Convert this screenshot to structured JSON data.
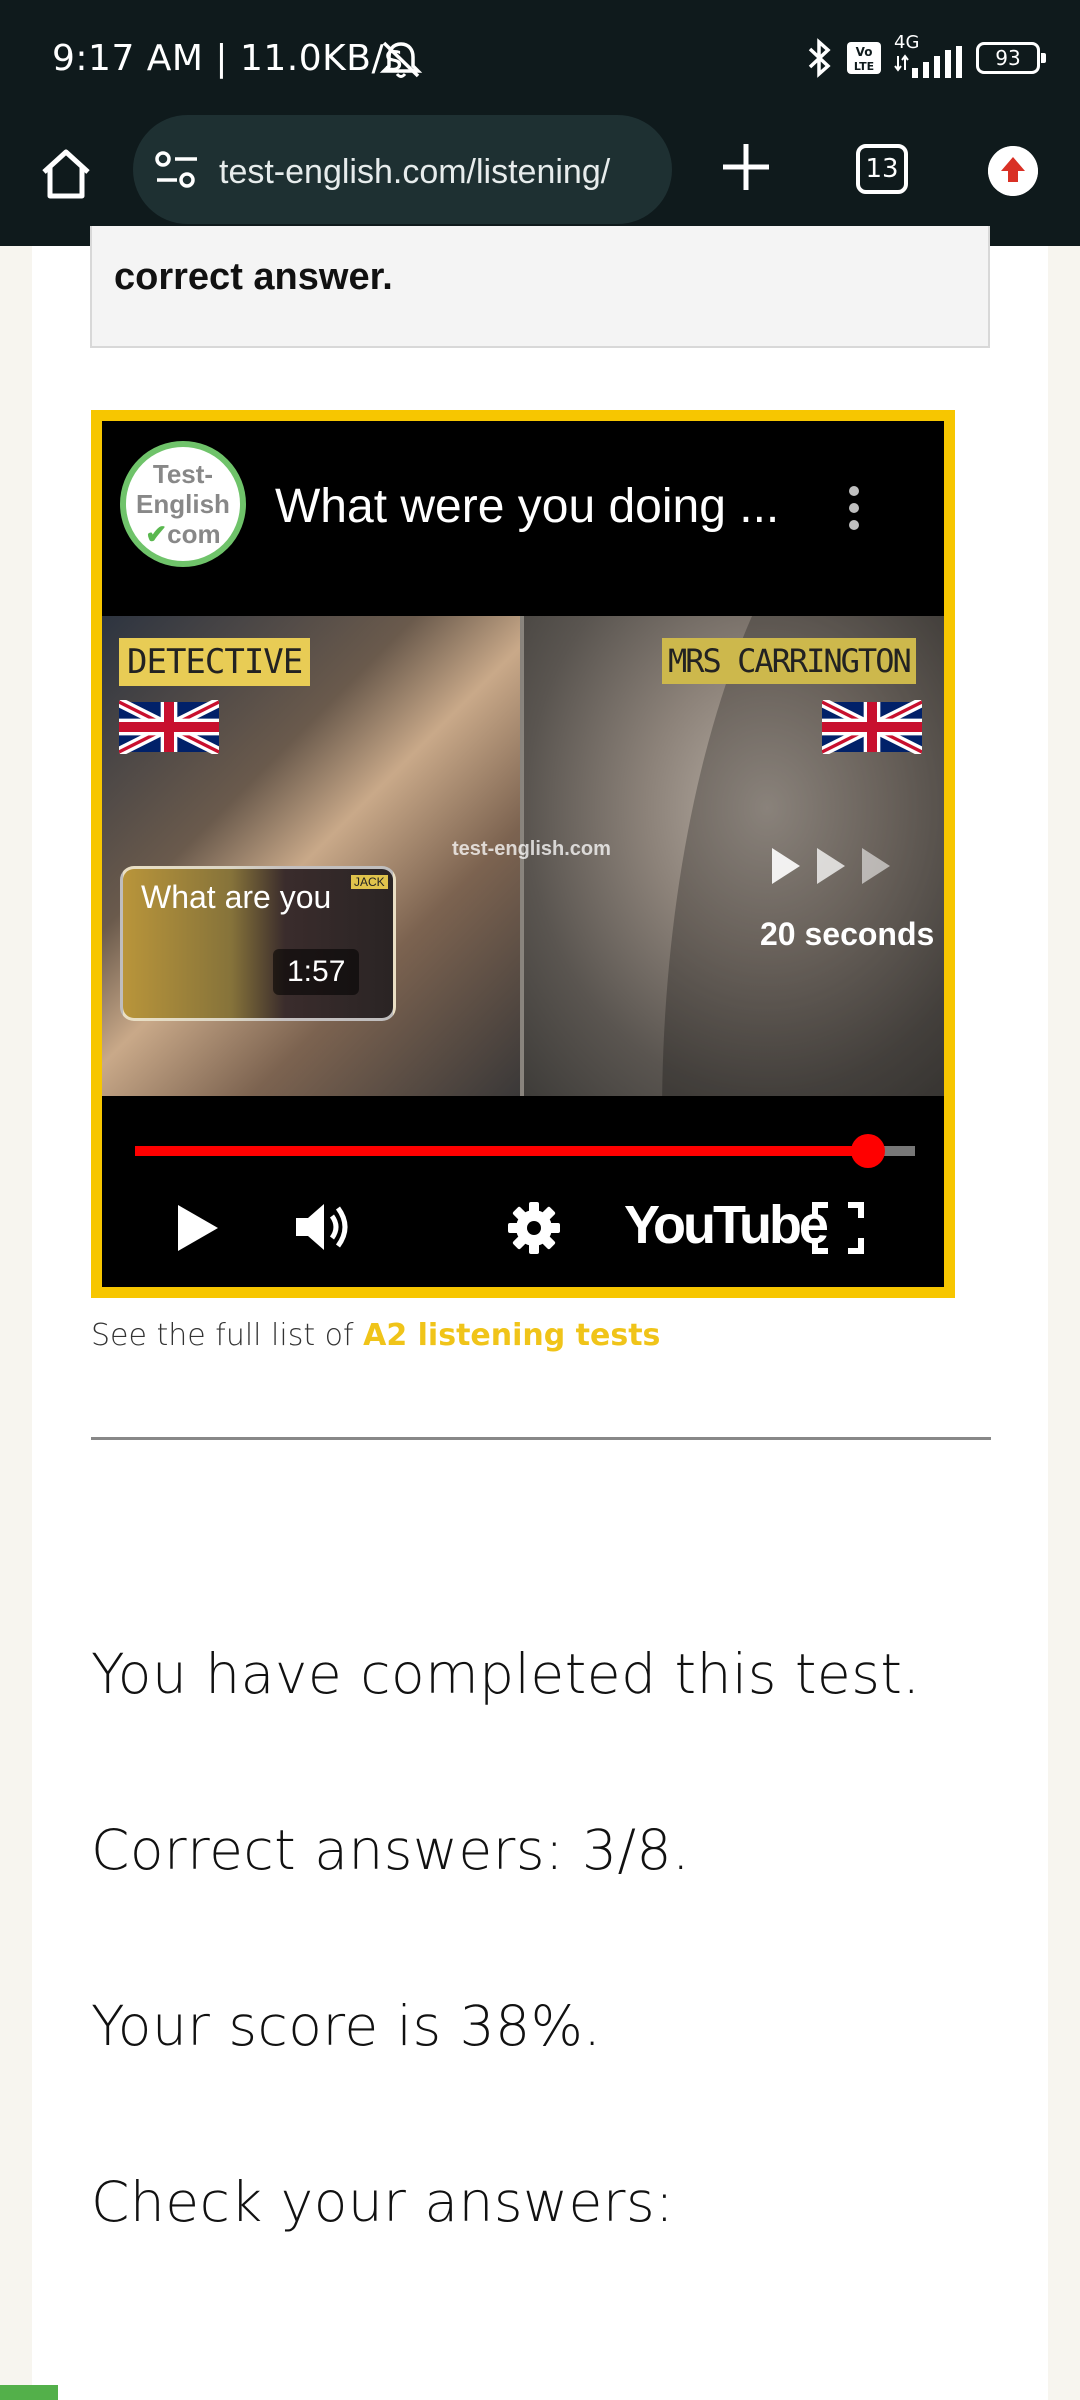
{
  "status_bar": {
    "time": "9:17 AM | 11.0KB/s",
    "network": "4G",
    "battery": "93"
  },
  "browser": {
    "url": "test-english.com/listening/",
    "tab_count": "13"
  },
  "page": {
    "answer_box_text": "correct answer.",
    "video": {
      "logo_text": [
        "Test-",
        "English",
        "com"
      ],
      "title": "What were you doing ...",
      "label_left": "DETECTIVE",
      "label_right": "MRS CARRINGTON",
      "watermark": "test-english.com",
      "mini_title": "What are you",
      "mini_tag": "JACK",
      "mini_duration": "1:57",
      "skip_text": "20 seconds",
      "youtube_label": "YouTube",
      "progress": 0.94
    },
    "full_list_prefix": "See the full list of ",
    "full_list_link": "A2 listening tests",
    "completed": "You have completed this test.",
    "correct_answers": "Correct answers: 3/8.",
    "score": "Your score is 38%.",
    "check": "Check your answers:"
  },
  "colors": {
    "accent_yellow": "#f7c600",
    "link_yellow": "#f0c419",
    "progress_red": "#ff0000",
    "status_bg": "#0f1a1c"
  }
}
